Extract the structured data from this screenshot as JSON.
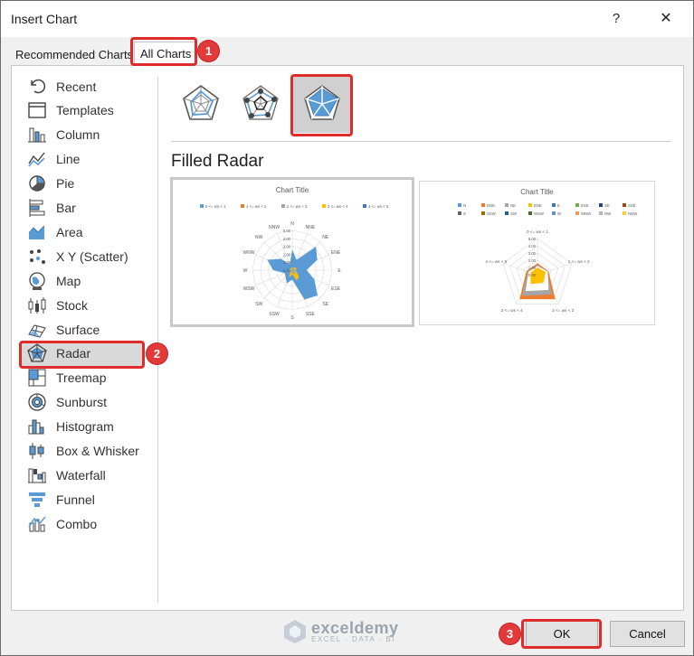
{
  "window": {
    "title": "Insert Chart",
    "help_label": "?",
    "close_label": "✕"
  },
  "tabs": [
    {
      "label": "Recommended Charts",
      "selected": false
    },
    {
      "label": "All Charts",
      "selected": true
    }
  ],
  "steps": [
    "1",
    "2",
    "3"
  ],
  "sidebar": {
    "items": [
      {
        "label": "Recent",
        "icon": "recent-icon"
      },
      {
        "label": "Templates",
        "icon": "templates-icon"
      },
      {
        "label": "Column",
        "icon": "column-chart-icon"
      },
      {
        "label": "Line",
        "icon": "line-chart-icon"
      },
      {
        "label": "Pie",
        "icon": "pie-chart-icon"
      },
      {
        "label": "Bar",
        "icon": "bar-chart-icon"
      },
      {
        "label": "Area",
        "icon": "area-chart-icon"
      },
      {
        "label": "X Y (Scatter)",
        "icon": "scatter-chart-icon"
      },
      {
        "label": "Map",
        "icon": "map-chart-icon"
      },
      {
        "label": "Stock",
        "icon": "stock-chart-icon"
      },
      {
        "label": "Surface",
        "icon": "surface-chart-icon"
      },
      {
        "label": "Radar",
        "icon": "radar-chart-icon"
      },
      {
        "label": "Treemap",
        "icon": "treemap-chart-icon"
      },
      {
        "label": "Sunburst",
        "icon": "sunburst-chart-icon"
      },
      {
        "label": "Histogram",
        "icon": "histogram-chart-icon"
      },
      {
        "label": "Box & Whisker",
        "icon": "box-whisker-chart-icon"
      },
      {
        "label": "Waterfall",
        "icon": "waterfall-chart-icon"
      },
      {
        "label": "Funnel",
        "icon": "funnel-chart-icon"
      },
      {
        "label": "Combo",
        "icon": "combo-chart-icon"
      }
    ],
    "selected_index": 11
  },
  "subtypes": [
    {
      "icon": "radar-icon",
      "selected": false
    },
    {
      "icon": "radar-with-markers-icon",
      "selected": false
    },
    {
      "icon": "filled-radar-icon",
      "selected": true
    }
  ],
  "variant_title": "Filled Radar",
  "previews": [
    {
      "title": "Chart Title",
      "legend": [
        "0 <= ws < 1",
        "1 <= ws < 2",
        "2 <= ws < 3",
        "3 <= ws < 4",
        "4 <= ws < 5"
      ],
      "axis_labels": [
        "N",
        "NNE",
        "NE",
        "ENE",
        "E",
        "ESE",
        "SE",
        "SSE",
        "S",
        "SSW",
        "SW",
        "WSW",
        "W",
        "WNW",
        "NW",
        "NNW"
      ],
      "ticks": [
        "5.00",
        "4.00",
        "3.00",
        "2.00",
        "1.00",
        "0.00"
      ]
    },
    {
      "title": "Chart Title",
      "legend": [
        "N",
        "NNE",
        "NE",
        "ENE",
        "E",
        "ESE",
        "SE",
        "SSE",
        "S",
        "SSW",
        "SW",
        "WSW",
        "W",
        "WNW",
        "NW",
        "NNW"
      ],
      "axis_labels": [
        "0 <= ws < 1",
        "1 <= ws < 2",
        "2 <= ws < 3",
        "3 <= ws < 4",
        "4 <= ws < 5"
      ],
      "ticks": [
        "5.00",
        "4.00",
        "3.00",
        "2.00",
        "1.00",
        "0.00"
      ]
    }
  ],
  "colors": {
    "accent_blue": "#5b9bd5",
    "orange": "#ed7d31",
    "gray": "#a5a5a5",
    "yellow": "#ffc000",
    "highlight_red": "#e02b2b",
    "selected_bg": "#d9d9d9"
  },
  "watermark": {
    "name": "exceldemy",
    "tagline": "EXCEL · DATA · BI"
  },
  "buttons": {
    "ok": "OK",
    "cancel": "Cancel"
  }
}
